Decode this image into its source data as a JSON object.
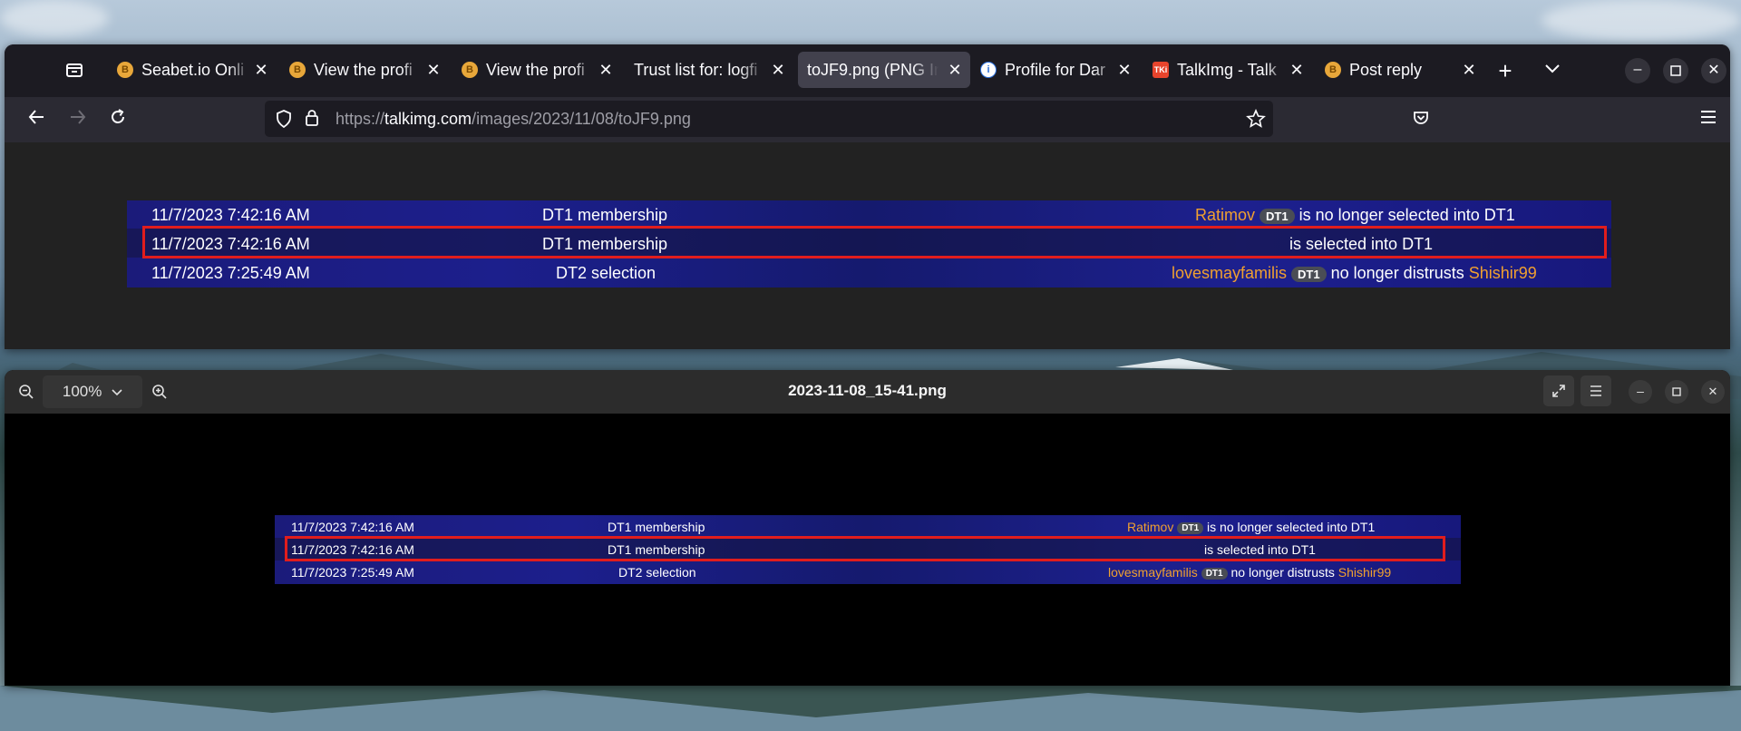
{
  "browser": {
    "tabs": [
      {
        "label": "Seabet.io Onli",
        "favicon": "coin-icon",
        "active": false
      },
      {
        "label": "View the profi",
        "favicon": "coin-icon",
        "active": false
      },
      {
        "label": "View the profi",
        "favicon": "coin-icon",
        "active": false
      },
      {
        "label": "Trust list for: logfi",
        "favicon": "none",
        "active": false
      },
      {
        "label": "toJF9.png (PNG Ir",
        "favicon": "none",
        "active": true
      },
      {
        "label": "Profile for Dar",
        "favicon": "info-icon",
        "active": false
      },
      {
        "label": "TalkImg - Talk",
        "favicon": "talkimg-icon",
        "active": false
      },
      {
        "label": "Post reply",
        "favicon": "coin-icon",
        "active": false
      }
    ],
    "favicon_text": {
      "talkimg": "TKi",
      "info": "i"
    },
    "url_scheme": "https://",
    "url_host": "talkimg.com",
    "url_path": "/images/2023/11/08/toJF9.png"
  },
  "log_rows": [
    {
      "time": "11/7/2023 7:42:16 AM",
      "type": "DT1 membership",
      "user": "Ratimov",
      "badge": "DT1",
      "text": "is no longer selected into DT1",
      "user2": "",
      "highlighted": false
    },
    {
      "time": "11/7/2023 7:42:16 AM",
      "type": "DT1 membership",
      "user": "",
      "badge": "",
      "text": "is selected into DT1",
      "user2": "",
      "highlighted": true
    },
    {
      "time": "11/7/2023 7:25:49 AM",
      "type": "DT2 selection",
      "user": "lovesmayfamilis",
      "badge": "DT1",
      "text": "no longer distrusts",
      "user2": "Shishir99",
      "highlighted": false
    }
  ],
  "viewer": {
    "title": "2023-11-08_15-41.png",
    "zoom": "100%"
  },
  "colors": {
    "accent_orange": "#f0a030",
    "highlight_red": "#e11d1d",
    "log_bg": "#1c1f8c"
  }
}
